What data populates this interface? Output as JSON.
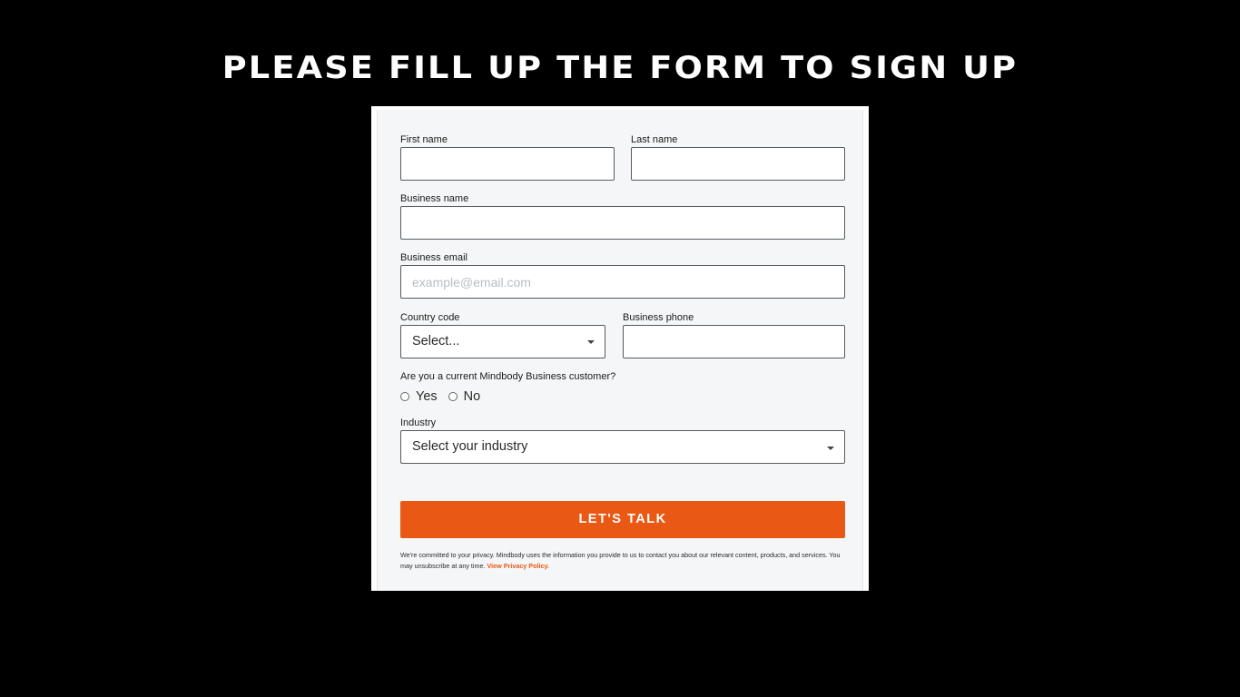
{
  "page": {
    "heading": "PLEASE FILL UP THE FORM TO SIGN UP"
  },
  "form": {
    "first_name": {
      "label": "First name",
      "value": "",
      "placeholder": ""
    },
    "last_name": {
      "label": "Last name",
      "value": "",
      "placeholder": ""
    },
    "business_name": {
      "label": "Business name",
      "value": "",
      "placeholder": ""
    },
    "business_email": {
      "label": "Business email",
      "value": "",
      "placeholder": "example@email.com"
    },
    "country_code": {
      "label": "Country code",
      "selected": "Select..."
    },
    "business_phone": {
      "label": "Business phone",
      "value": "",
      "placeholder": ""
    },
    "customer_question": {
      "label": "Are you a current Mindbody Business customer?",
      "options": [
        "Yes",
        "No"
      ]
    },
    "industry": {
      "label": "Industry",
      "selected": "Select your industry"
    },
    "submit_label": "LET'S TALK",
    "privacy_text": "We're committed to your privacy. Mindbody uses the information you provide to us to contact you about our relevant content, products, and services. You may unsubscribe at any time.",
    "privacy_link": "View Privacy Policy."
  },
  "colors": {
    "accent": "#e95814",
    "background": "#000000",
    "form_background": "#f5f6f7"
  },
  "icons": {
    "select_caret": "chevron-down-icon"
  }
}
